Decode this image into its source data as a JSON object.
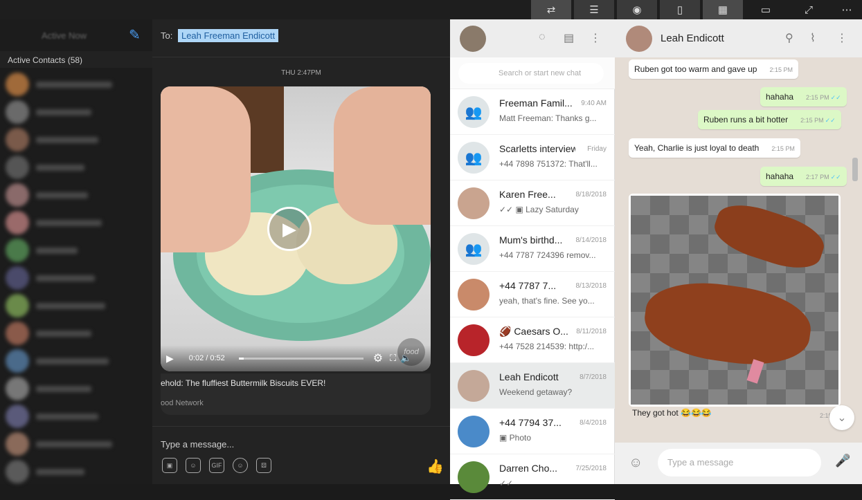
{
  "topbar": {
    "icons": [
      "swap-icon",
      "contacts-list-icon",
      "view-icon",
      "layout-single-icon",
      "layout-split-icon",
      "window-icon",
      "expand-icon",
      "more-icon"
    ],
    "glyphs": [
      "⇄",
      "☰",
      "◉",
      "▯",
      "▦",
      "▭",
      "⤢",
      "⋯"
    ]
  },
  "messenger": {
    "sidebar": {
      "title": "Active Now",
      "active_contacts": "Active Contacts (58)"
    },
    "chat": {
      "to_label": "To:",
      "recipient": "Leah Freeman Endicott",
      "timestamp": "THU 2:47PM",
      "video": {
        "time": "0:02 / 0:52",
        "progress": 0.04,
        "logo_text": "food"
      },
      "caption": "ehold: The fluffiest Buttermilk Biscuits EVER!",
      "source": "ood Network",
      "input_placeholder": "Type a message...",
      "tools": [
        "gallery-icon",
        "sticker-icon",
        "gif-icon",
        "emoji-icon",
        "game-icon"
      ],
      "tool_labels": [
        "▣",
        "☺",
        "GIF",
        "☺",
        "⚄"
      ]
    }
  },
  "whatsapp": {
    "search_placeholder": "Search or start new chat",
    "chats": [
      {
        "name": "Freeman Famil...",
        "date": "9:40 AM",
        "preview": "Matt Freeman: Thanks g...",
        "avatar": "group"
      },
      {
        "name": "Scarletts interview",
        "date": "Friday",
        "preview": "+44 7898 751372: That'll...",
        "avatar": "group"
      },
      {
        "name": "Karen Free...",
        "date": "8/18/2018",
        "preview": "✓✓ ▣ Lazy Saturday",
        "avatar": "photo"
      },
      {
        "name": "Mum's birthd...",
        "date": "8/14/2018",
        "preview": "+44 7787 724396 remov...",
        "avatar": "group"
      },
      {
        "name": "+44 7787 7...",
        "date": "8/13/2018",
        "preview": "yeah, that's fine. See yo...",
        "avatar": "photo"
      },
      {
        "name": "🏈 Caesars O...",
        "date": "8/11/2018",
        "preview": "+44 7528 214539: http:/...",
        "avatar": "photo"
      },
      {
        "name": "Leah Endicott",
        "date": "8/7/2018",
        "preview": "Weekend getaway?",
        "avatar": "photo",
        "selected": true
      },
      {
        "name": "+44 7794 37...",
        "date": "8/4/2018",
        "preview": "▣ Photo",
        "avatar": "photo"
      },
      {
        "name": "Darren Cho...",
        "date": "7/25/2018",
        "preview": "✓✓",
        "avatar": "photo"
      }
    ],
    "conversation": {
      "contact": "Leah Endicott",
      "messages": [
        {
          "dir": "in",
          "text": "Ruben got too warm and gave up",
          "time": "2:15 PM"
        },
        {
          "dir": "out",
          "text": "hahaha",
          "time": "2:15 PM"
        },
        {
          "dir": "out",
          "text": "Ruben runs a bit hotter",
          "time": "2:15 PM"
        },
        {
          "dir": "in",
          "text": "Yeah, Charlie is just loyal to death",
          "time": "2:15 PM"
        },
        {
          "dir": "out",
          "text": "hahaha",
          "time": "2:17 PM"
        }
      ],
      "photo_caption": "They got hot 😂😂😂",
      "photo_time": "2:19 P",
      "input_placeholder": "Type a message"
    }
  }
}
